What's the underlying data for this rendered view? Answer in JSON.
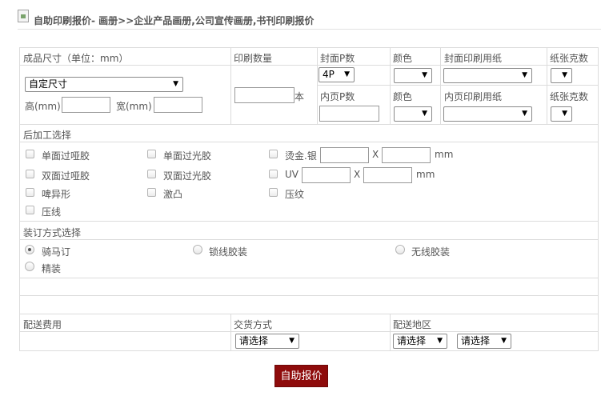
{
  "header": {
    "title": "自助印刷报价- 画册>>企业产品画册,公司宣传画册,书刊印刷报价"
  },
  "size_section": {
    "label": "成品尺寸（单位：mm）",
    "size_select": "自定尺寸",
    "height_label": "高(mm)",
    "width_label": "宽(mm)"
  },
  "quantity": {
    "label": "印刷数量",
    "unit": "本"
  },
  "cover": {
    "pages_label": "封面P数",
    "pages_value": "4P",
    "color_label": "颜色",
    "paper_label": "封面印刷用纸",
    "weight_label": "纸张克数"
  },
  "inner": {
    "pages_label": "内页P数",
    "color_label": "颜色",
    "paper_label": "内页印刷用纸",
    "weight_label": "纸张克数"
  },
  "post_processing": {
    "label": "后加工选择",
    "options": [
      "单面过哑胶",
      "单面过光胶",
      "烫金.银",
      "双面过哑胶",
      "双面过光胶",
      "UV",
      "啤异形",
      "激凸",
      "压纹",
      "压线"
    ],
    "times_sign": "X",
    "unit": "mm"
  },
  "binding": {
    "label": "装订方式选择",
    "options": [
      "骑马订",
      "锁线胶装",
      "无线胶装",
      "精装"
    ],
    "selected": "骑马订"
  },
  "delivery": {
    "fee_label": "配送费用",
    "method_label": "交货方式",
    "region_label": "配送地区",
    "method_value": "请选择",
    "region_value_1": "请选择",
    "region_value_2": "请选择"
  },
  "submit_label": "自助报价",
  "colors": {
    "button": "#8e0b0b",
    "border": "#dcdcdc"
  }
}
